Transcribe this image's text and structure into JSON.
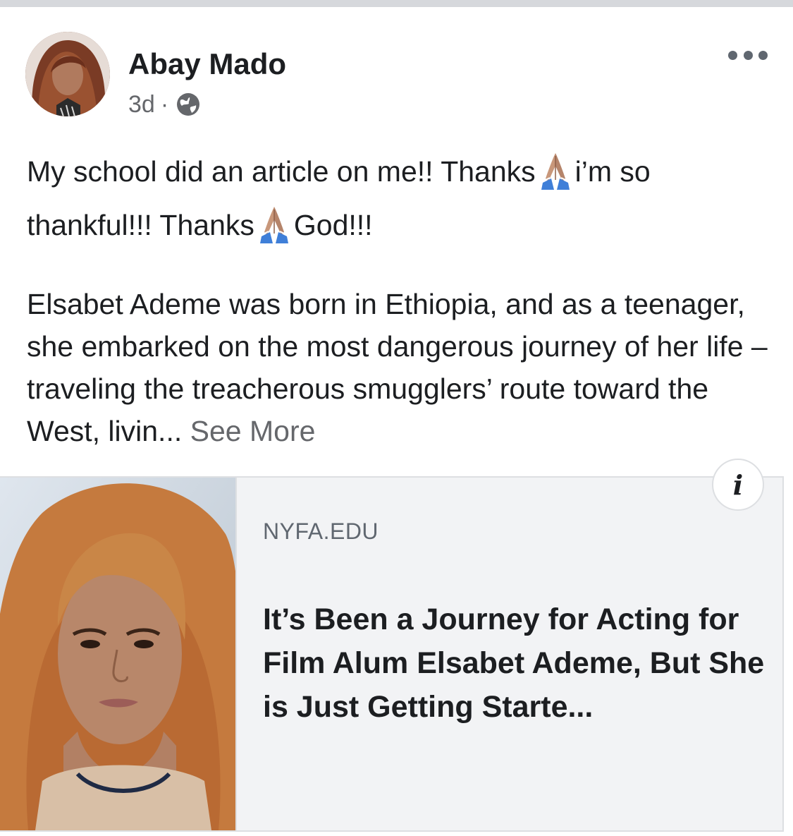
{
  "post": {
    "author": "Abay Mado",
    "time": "3d",
    "separator": "·",
    "privacy_icon": "globe-icon",
    "more_icon": "more-options-icon",
    "text": {
      "line1_a": "My school did an article on me!! Thanks",
      "line1_b": "i’m so",
      "line2_a": "thankful!!! Thanks",
      "line2_b": "God!!!",
      "emoji": "folded-hands-icon",
      "paragraph2": "Elsabet Ademe was born in Ethiopia, and as a teenager, she embarked on the most dangerous journey of her life – traveling the treacherous smugglers’ route toward the West, livin...",
      "see_more": "See More"
    }
  },
  "link_card": {
    "domain": "NYFA.EDU",
    "title": "It’s Been a Journey for Acting for Film Alum Elsabet Ademe, But She is Just Getting Starte...",
    "info_label": "i"
  },
  "colors": {
    "text_primary": "#1c1e21",
    "text_secondary": "#65676b",
    "card_background": "#f2f3f5",
    "border": "#dddfe2"
  }
}
